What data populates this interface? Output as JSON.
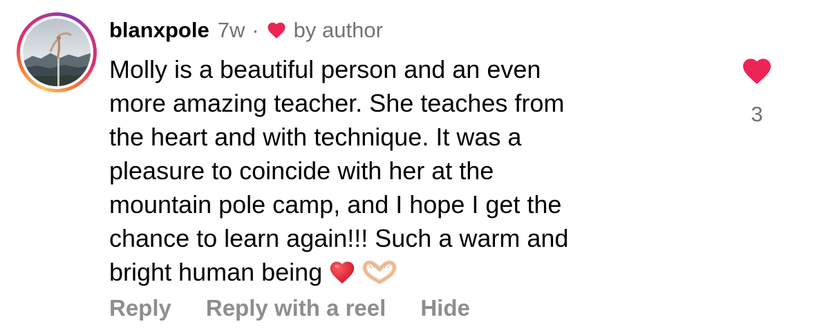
{
  "comment": {
    "username": "blanxpole",
    "time": "7w",
    "separator": "·",
    "author_badge": "by author",
    "body_lines": [
      "Molly is a beautiful person and an even",
      "more amazing teacher. She teaches from",
      "the heart and with technique. It was a",
      "pleasure to coincide with her at the",
      "mountain pole camp, and I hope I get the",
      "chance to learn again!!! Such a warm and",
      "bright human being"
    ],
    "body_emojis": [
      "red-heart-emoji",
      "heart-hands-emoji"
    ],
    "like_count": "3"
  },
  "actions": {
    "reply": "Reply",
    "reply_with_reel": "Reply with a reel",
    "hide": "Hide"
  },
  "colors": {
    "heart_red": "#ed2456",
    "secondary_text": "#737373",
    "action_text": "#8e8e8e"
  },
  "icons": {
    "author_like": "heart-icon",
    "like_button": "heart-icon"
  }
}
